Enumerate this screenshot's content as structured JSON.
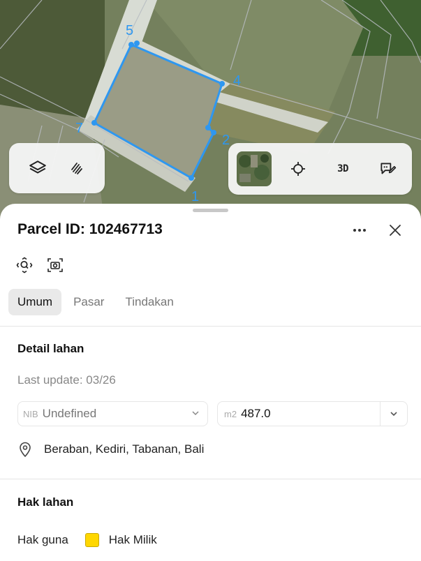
{
  "map": {
    "vertex_labels": [
      "5",
      "4",
      "2",
      "1",
      "7"
    ],
    "parcel_color": "#2e97f0",
    "toolbar_left": {
      "layers_icon": "layers-icon",
      "draw_icon": "hand-pointer-icon"
    },
    "toolbar_right": {
      "thumbnail_icon": "satellite-thumbnail",
      "locate_icon": "crosshair-icon",
      "three_d_label": "3D",
      "feedback_icon": "chat-edit-icon"
    }
  },
  "sheet": {
    "title": "Parcel ID: 102467713",
    "tabs": [
      "Umum",
      "Pasar",
      "Tindakan"
    ],
    "active_tab": "Umum",
    "detail": {
      "heading": "Detail lahan",
      "last_update": "Last update: 03/26",
      "nib_prefix": "NIB",
      "nib_value": "Undefined",
      "area_prefix": "m2",
      "area_value": "487.0",
      "location": "Beraban, Kediri, Tabanan, Bali"
    },
    "rights": {
      "heading": "Hak lahan",
      "label": "Hak guna",
      "value": "Hak Milik",
      "swatch_color": "#ffd700"
    }
  }
}
